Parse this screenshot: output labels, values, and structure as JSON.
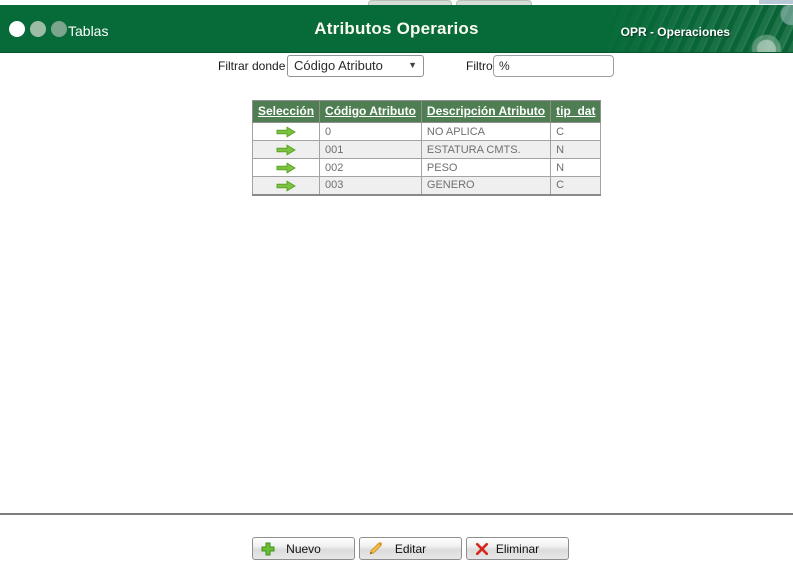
{
  "header": {
    "app_title": "Tablas",
    "page_title": "Atributos Operarios",
    "module_label": "OPR - Operaciones"
  },
  "filter": {
    "where_label": "Filtrar donde",
    "where_value": "Código Atributo",
    "filter_label": "Filtro",
    "filter_value": "%"
  },
  "table": {
    "columns": [
      "Selección",
      "Código Atributo",
      "Descripción Atributo",
      "tip_dat"
    ],
    "rows": [
      {
        "codigo": "0",
        "descripcion": "NO APLICA",
        "tip_dat": "C"
      },
      {
        "codigo": "001",
        "descripcion": "ESTATURA CMTS.",
        "tip_dat": "N"
      },
      {
        "codigo": "002",
        "descripcion": "PESO",
        "tip_dat": "N"
      },
      {
        "codigo": "003",
        "descripcion": "GENERO",
        "tip_dat": "C"
      }
    ]
  },
  "actions": {
    "new_label": "Nuevo",
    "edit_label": "Editar",
    "delete_label": "Eliminar"
  },
  "colors": {
    "header_green": "#076a39",
    "table_header_green": "#4e7e52",
    "row_alt_gray": "#efefef",
    "arrow_green": "#7cc142",
    "new_icon_green": "#6cbf33",
    "edit_icon_orange": "#f5c13f",
    "delete_icon_red": "#d5281b"
  }
}
